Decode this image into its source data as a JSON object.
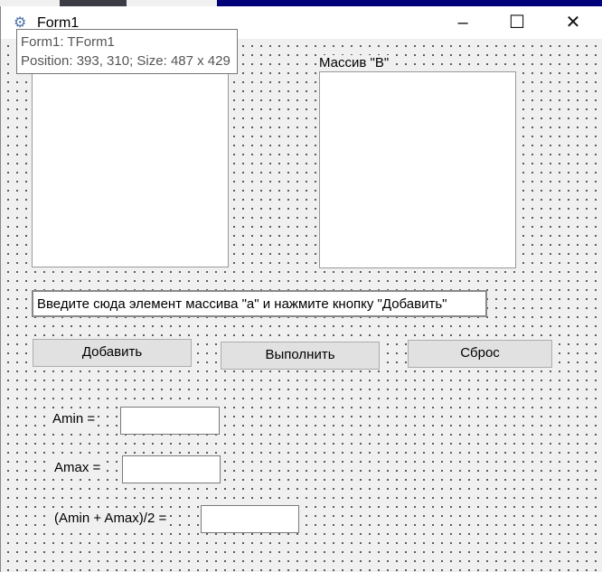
{
  "window": {
    "title": "Form1",
    "minimize": "–",
    "maximize": "☐",
    "close": "✕"
  },
  "tooltip": {
    "line1": "Form1: TForm1",
    "line2": "Position: 393, 310; Size: 487 x 429"
  },
  "form": {
    "array_b_label": "Массив \"B\"",
    "input_hint": "Введите сюда элемент массива \"а\" и нажмите кнопку \"Добавить\"",
    "buttons": {
      "add": "Добавить",
      "run": "Выполнить",
      "reset": "Сброс"
    },
    "amin_label": "Amin =",
    "amax_label": "Amax =",
    "avg_label": "(Amin + Amax)/2 =",
    "amin_value": "",
    "amax_value": "",
    "avg_value": ""
  }
}
